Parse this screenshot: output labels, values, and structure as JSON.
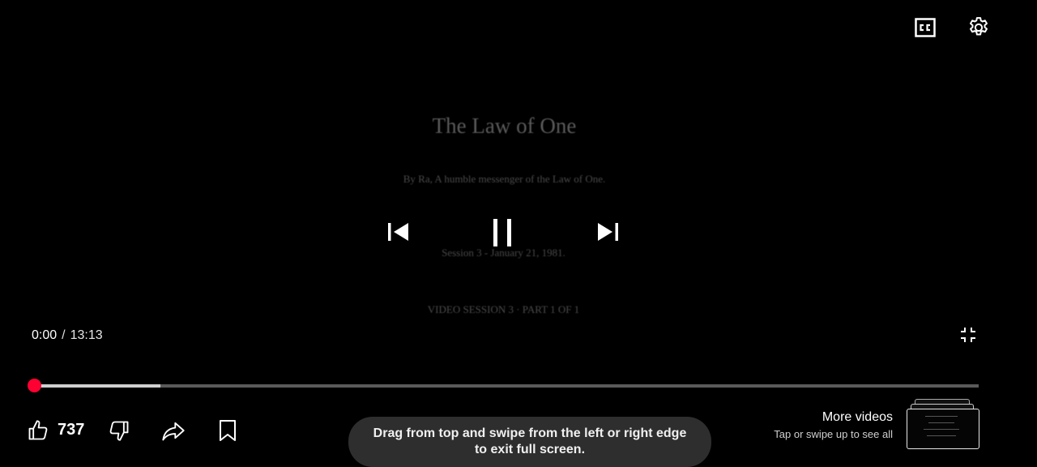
{
  "slide": {
    "title": "The Law of One",
    "subtitle": "By Ra, A humble messenger of the Law of One.",
    "session": "Session 3 - January 21, 1981.",
    "part": "VIDEO SESSION 3   ·   PART 1 OF 1"
  },
  "player": {
    "current_time": "0:00",
    "separator": "/",
    "duration": "13:13",
    "progress_fraction": 0.0,
    "buffered_fraction": 0.134,
    "accent_color": "#ff0033",
    "icons": {
      "captions": "cc-icon",
      "settings": "gear-icon",
      "previous": "skip-previous-icon",
      "pause": "pause-icon",
      "next": "skip-next-icon",
      "exit_fullscreen": "exit-fullscreen-icon"
    }
  },
  "actions": {
    "like_count": "737",
    "icons": {
      "like": "thumbs-up-icon",
      "dislike": "thumbs-down-icon",
      "share": "share-icon",
      "save": "bookmark-icon"
    }
  },
  "toast": {
    "message": "Drag from top and swipe from the left or right edge to exit full screen."
  },
  "more_videos": {
    "title": "More videos",
    "hint": "Tap or swipe up to see all"
  }
}
